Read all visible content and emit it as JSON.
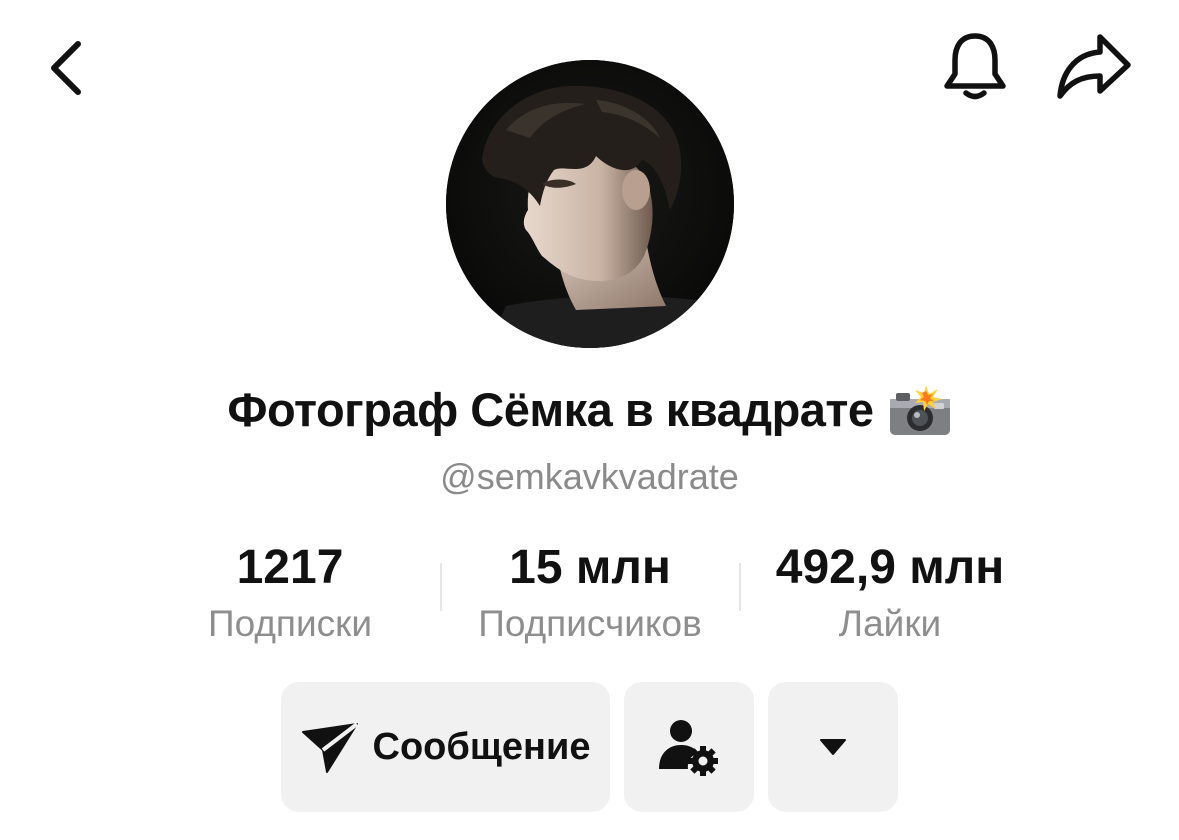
{
  "header": {
    "back_icon": "chevron-left-icon",
    "notifications_icon": "bell-icon",
    "share_icon": "share-arrow-icon"
  },
  "profile": {
    "avatar": "profile-photo",
    "name": "Фотограф Сёмка в квадрате",
    "name_emoji": "camera-with-flash-emoji",
    "username": "@semkavkvadrate"
  },
  "stats": [
    {
      "value": "1217",
      "label": "Подписки"
    },
    {
      "value": "15 млн",
      "label": "Подписчиков"
    },
    {
      "value": "492,9 млн",
      "label": "Лайки"
    }
  ],
  "actions": {
    "message_label": "Сообщение",
    "message_icon": "send-icon",
    "add_friend_icon": "user-settings-icon",
    "more_icon": "caret-down-icon"
  }
}
